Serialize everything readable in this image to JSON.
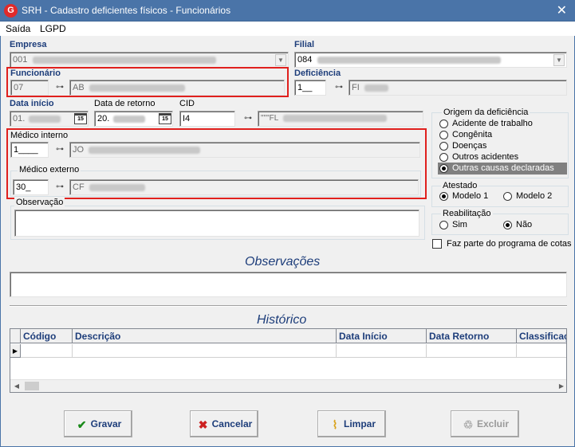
{
  "window": {
    "title": "SRH - Cadastro deficientes físicos - Funcionários",
    "app_icon_letter": "G"
  },
  "menu": [
    "Saída",
    "LGPD"
  ],
  "empresa": {
    "label": "Empresa",
    "code": "001"
  },
  "filial": {
    "label": "Filial",
    "code": "084"
  },
  "funcionario": {
    "label": "Funcionário",
    "code": "07",
    "name": "AB"
  },
  "deficiencia": {
    "label": "Deficiência",
    "code": "1__",
    "name": "FI"
  },
  "data_inicio": {
    "label": "Data início",
    "value": "01."
  },
  "data_retorno": {
    "label": "Data de retorno",
    "value": "20."
  },
  "cid": {
    "label": "CID",
    "code": "I4",
    "desc": "\"\"\"FL"
  },
  "calendar_icon_text": "15",
  "medico_interno": {
    "label": "Médico interno",
    "code": "1____",
    "name": "JO"
  },
  "medico_externo": {
    "label": "Médico externo",
    "code": "30_",
    "name": "CF"
  },
  "observacao_label": "Observação",
  "origem": {
    "title": "Origem da deficiência",
    "options": [
      "Acidente de trabalho",
      "Congênita",
      "Doenças",
      "Outros acidentes",
      "Outras causas declaradas"
    ],
    "selected": 4
  },
  "atestado": {
    "title": "Atestado",
    "options": [
      "Modelo 1",
      "Modelo 2"
    ],
    "selected": 0
  },
  "reabilitacao": {
    "title": "Reabilitação",
    "options": [
      "Sim",
      "Não"
    ],
    "selected": 1
  },
  "programa_cotas": {
    "label": "Faz parte do programa de cotas",
    "checked": false
  },
  "observacoes_title": "Observações",
  "historico": {
    "title": "Histórico",
    "columns": [
      "Código",
      "Descrição",
      "Data Início",
      "Data Retorno",
      "Classificaç"
    ]
  },
  "buttons": {
    "gravar": "Gravar",
    "cancelar": "Cancelar",
    "limpar": "Limpar",
    "excluir": "Excluir"
  },
  "colors": {
    "titlebar": "#4a74a8",
    "label_blue": "#1d3d7a",
    "highlight_red": "#e0201d"
  }
}
